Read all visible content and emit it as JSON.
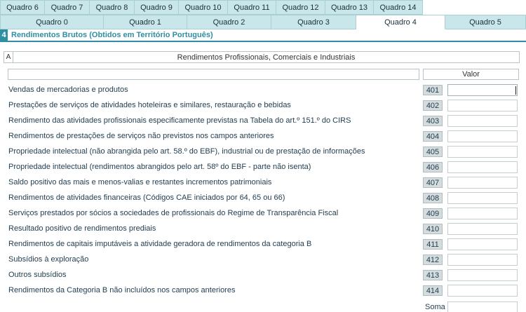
{
  "tabs_top": [
    "Quadro 6",
    "Quadro 7",
    "Quadro 8",
    "Quadro 9",
    "Quadro 10",
    "Quadro 11",
    "Quadro 12",
    "Quadro 13",
    "Quadro 14"
  ],
  "tabs_bottom": [
    "Quadro 0",
    "Quadro 1",
    "Quadro 2",
    "Quadro 3",
    "Quadro 4",
    "Quadro 5"
  ],
  "active_tab": "Quadro 4",
  "section": {
    "number": "4",
    "title": "Rendimentos Brutos (Obtidos em Território Português)"
  },
  "subsection": {
    "letter": "A",
    "title": "Rendimentos Profissionais, Comerciais e Industriais"
  },
  "columns": {
    "value_header": "Valor"
  },
  "rows": [
    {
      "label": "Vendas de mercadorias e produtos",
      "code": "401",
      "value": ""
    },
    {
      "label": "Prestações de serviços de atividades hoteleiras e similares, restauração e bebidas",
      "code": "402",
      "value": ""
    },
    {
      "label": "Rendimento das atividades profissionais especificamente previstas na Tabela do art.º 151.º do CIRS",
      "code": "403",
      "value": ""
    },
    {
      "label": "Rendimentos de prestações de serviços não previstos nos campos anteriores",
      "code": "404",
      "value": ""
    },
    {
      "label": "Propriedade intelectual (não abrangida pelo art. 58.º do EBF), industrial ou de prestação de informações",
      "code": "405",
      "value": ""
    },
    {
      "label": "Propriedade intelectual (rendimentos abrangidos pelo art. 58º do EBF - parte não isenta)",
      "code": "406",
      "value": ""
    },
    {
      "label": "Saldo positivo das mais e menos-valias e restantes incrementos patrimoniais",
      "code": "407",
      "value": ""
    },
    {
      "label": "Rendimentos de atividades financeiras (Códigos CAE iniciados por 64, 65 ou 66)",
      "code": "408",
      "value": ""
    },
    {
      "label": "Serviços prestados por sócios a sociedades de profissionais do Regime de Transparência Fiscal",
      "code": "409",
      "value": ""
    },
    {
      "label": "Resultado positivo de rendimentos prediais",
      "code": "410",
      "value": ""
    },
    {
      "label": "Rendimentos de capitais imputáveis a atividade geradora de rendimentos da categoria B",
      "code": "411",
      "value": ""
    },
    {
      "label": "Subsídios à exploração",
      "code": "412",
      "value": ""
    },
    {
      "label": "Outros subsídios",
      "code": "413",
      "value": ""
    },
    {
      "label": "Rendimentos da Categoria B não incluídos nos campos anteriores",
      "code": "414",
      "value": ""
    }
  ],
  "sum": {
    "label": "Soma",
    "value": ""
  },
  "colors": {
    "tab_bg": "#c9e7ea",
    "accent": "#2e8fa3",
    "code_bg": "#d5dcdd"
  }
}
